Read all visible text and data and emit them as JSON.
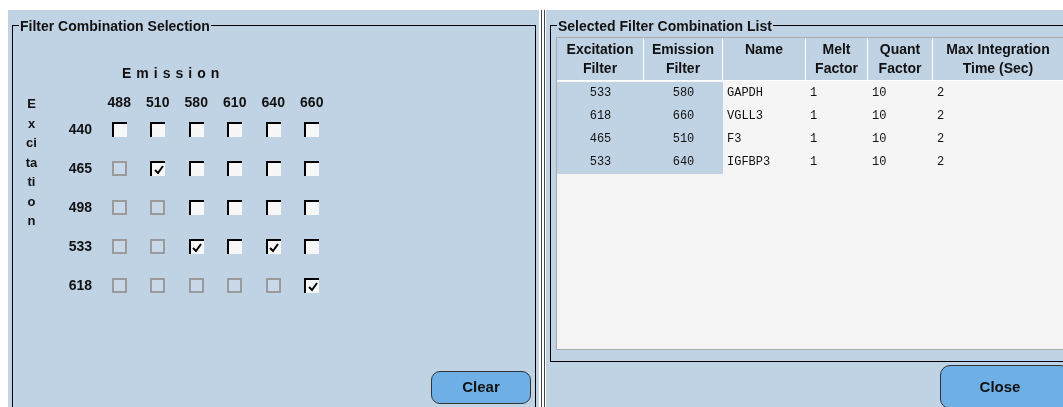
{
  "filter_selection": {
    "title": "Filter Combination Selection",
    "emission_label": "Emission",
    "excitation_label": "Excitation",
    "emission_columns": [
      "488",
      "510",
      "580",
      "610",
      "640",
      "660"
    ],
    "rows": [
      {
        "label": "440",
        "cells": [
          {
            "checked": false,
            "disabled": false
          },
          {
            "checked": false,
            "disabled": false
          },
          {
            "checked": false,
            "disabled": false
          },
          {
            "checked": false,
            "disabled": false
          },
          {
            "checked": false,
            "disabled": false
          },
          {
            "checked": false,
            "disabled": false
          }
        ]
      },
      {
        "label": "465",
        "cells": [
          {
            "checked": false,
            "disabled": true
          },
          {
            "checked": true,
            "disabled": false
          },
          {
            "checked": false,
            "disabled": false
          },
          {
            "checked": false,
            "disabled": false
          },
          {
            "checked": false,
            "disabled": false
          },
          {
            "checked": false,
            "disabled": false
          }
        ]
      },
      {
        "label": "498",
        "cells": [
          {
            "checked": false,
            "disabled": true
          },
          {
            "checked": false,
            "disabled": true
          },
          {
            "checked": false,
            "disabled": false
          },
          {
            "checked": false,
            "disabled": false
          },
          {
            "checked": false,
            "disabled": false
          },
          {
            "checked": false,
            "disabled": false
          }
        ]
      },
      {
        "label": "533",
        "cells": [
          {
            "checked": false,
            "disabled": true
          },
          {
            "checked": false,
            "disabled": true
          },
          {
            "checked": true,
            "disabled": false
          },
          {
            "checked": false,
            "disabled": false
          },
          {
            "checked": true,
            "disabled": false
          },
          {
            "checked": false,
            "disabled": false
          }
        ]
      },
      {
        "label": "618",
        "cells": [
          {
            "checked": false,
            "disabled": true
          },
          {
            "checked": false,
            "disabled": true
          },
          {
            "checked": false,
            "disabled": true
          },
          {
            "checked": false,
            "disabled": true
          },
          {
            "checked": false,
            "disabled": true
          },
          {
            "checked": true,
            "disabled": false
          }
        ]
      }
    ],
    "clear_button": "Clear"
  },
  "combination_list": {
    "title": "Selected Filter Combination List",
    "columns": [
      "Excitation Filter",
      "Emission Filter",
      "Name",
      "Melt Factor",
      "Quant Factor",
      "Max Integration Time (Sec)"
    ],
    "rows": [
      [
        "533",
        "580",
        "GAPDH",
        "1",
        "10",
        "2"
      ],
      [
        "618",
        "660",
        "VGLL3",
        "1",
        "10",
        "2"
      ],
      [
        "465",
        "510",
        "F3",
        "1",
        "10",
        "2"
      ],
      [
        "533",
        "640",
        "IGFBP3",
        "1",
        "10",
        "2"
      ]
    ],
    "close_button": "Close"
  }
}
